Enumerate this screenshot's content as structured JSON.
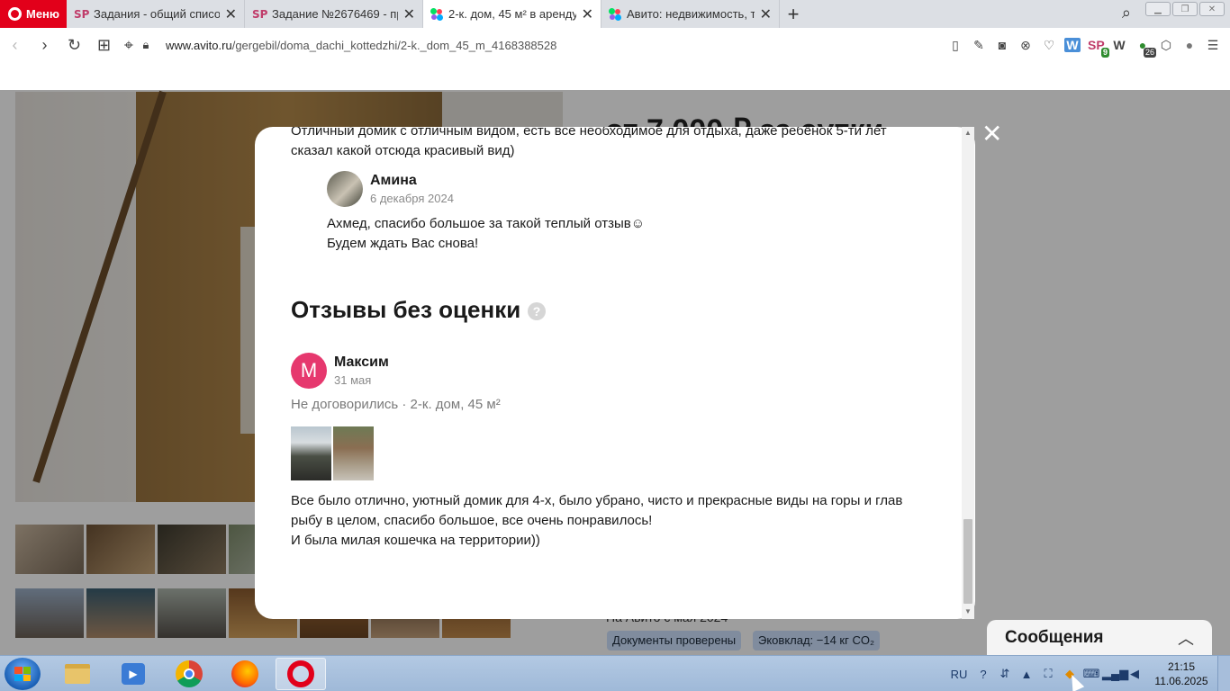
{
  "browser": {
    "menu_label": "Меню",
    "tabs": [
      {
        "icon": "SP",
        "title": "Задания - общий список s",
        "active": false
      },
      {
        "icon": "SP",
        "title": "Задание №2676469 - про",
        "active": false
      },
      {
        "icon": "avito",
        "title": "2-к. дом, 45 м² в аренду в",
        "active": true
      },
      {
        "icon": "avito",
        "title": "Авито: недвижимость, тра",
        "active": false
      }
    ],
    "url_domain": "www.avito.ru",
    "url_path": "/gergebil/doma_dachi_kottedzhi/2-k._dom_45_m_4168388528",
    "ext_badge_sp": "9",
    "ext_badge_green": "26"
  },
  "listing": {
    "price": "от 7 000 ₽ за сутки",
    "posted": "На Авито с мая 2024",
    "tags": [
      "Документы проверены",
      "Эковклад: −14 кг CO₂"
    ]
  },
  "modal": {
    "prev_review_text_1": "Отличный домик с отличным видом, есть все необходимое для отдыха, даже ребёнок 5-ти лет",
    "prev_review_text_2": "сказал какой отсюда красивый вид)",
    "reply": {
      "author": "Амина",
      "date": "6 декабря 2024",
      "text_1": "Ахмед, спасибо большое за такой теплый отзыв☺",
      "text_2": "Будем ждать Вас снова!"
    },
    "section_title": "Отзывы без оценки",
    "help_icon": "?",
    "review": {
      "avatar_letter": "М",
      "author": "Максим",
      "date": "31 мая",
      "meta": "Не договорились · 2-к. дом, 45 м²",
      "text_1": "Все было отлично, уютный домик для 4-х, было убрано, чисто и прекрасные виды на горы и глав",
      "text_2": "рыбу в целом, спасибо большое, все очень понравилось!",
      "text_3": "И была милая кошечка на территории))"
    }
  },
  "messages": {
    "title": "Сообщения"
  },
  "taskbar": {
    "lang": "RU",
    "time": "21:15",
    "date": "11.06.2025"
  },
  "colors": {
    "opera_red": "#e2001a",
    "avatar_pink": "#e6386e",
    "tag_blue": "#cfe3ff"
  }
}
